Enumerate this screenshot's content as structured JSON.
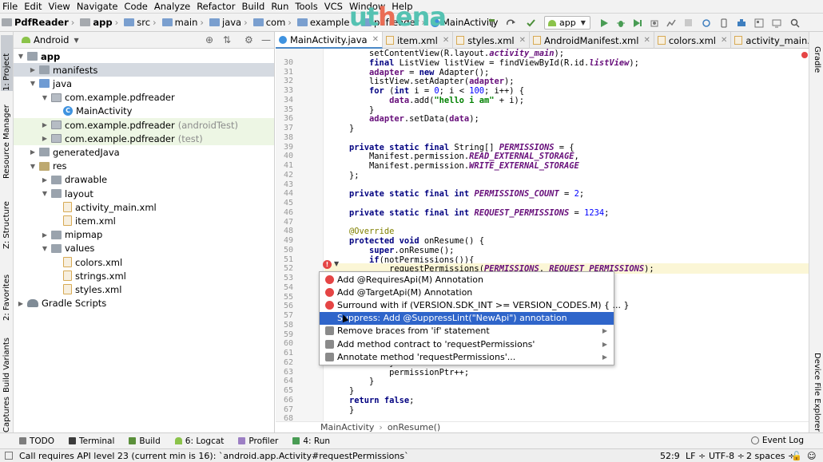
{
  "menu": [
    "File",
    "Edit",
    "View",
    "Navigate",
    "Code",
    "Analyze",
    "Refactor",
    "Build",
    "Run",
    "Tools",
    "VCS",
    "Window",
    "Help"
  ],
  "breadcrumbs": [
    {
      "label": "PdfReader",
      "bold": true
    },
    {
      "label": "app",
      "bold": true
    },
    {
      "label": "src"
    },
    {
      "label": "main"
    },
    {
      "label": "java"
    },
    {
      "label": "com"
    },
    {
      "label": "example"
    },
    {
      "label": "pdfreader"
    },
    {
      "label": "MainActivity"
    }
  ],
  "watermark": {
    "part1": "ut",
    "part2": "h",
    "part3": "ena"
  },
  "run_config": "app",
  "left_tool_windows": [
    "1: Project",
    "Resource Manager",
    "Z: Structure",
    "2: Favorites",
    "Build Variants",
    "Captures"
  ],
  "right_tool_windows": [
    "Gradle",
    "Device File Explorer"
  ],
  "project": {
    "view_mode": "Android",
    "tree": [
      {
        "label": "app",
        "depth": 0,
        "expanded": true,
        "icon": "folder",
        "bold": true
      },
      {
        "label": "manifests",
        "depth": 1,
        "expanded": false,
        "icon": "folder",
        "selected": true
      },
      {
        "label": "java",
        "depth": 1,
        "expanded": true,
        "icon": "folder-src"
      },
      {
        "label": "com.example.pdfreader",
        "depth": 2,
        "expanded": true,
        "icon": "package"
      },
      {
        "label": "MainActivity",
        "depth": 3,
        "icon": "class"
      },
      {
        "label": "com.example.pdfreader",
        "suffix": "(androidTest)",
        "depth": 2,
        "expanded": false,
        "icon": "package",
        "green": true
      },
      {
        "label": "com.example.pdfreader",
        "suffix": "(test)",
        "depth": 2,
        "expanded": false,
        "icon": "package",
        "green": true
      },
      {
        "label": "generatedJava",
        "depth": 1,
        "expanded": false,
        "icon": "folder"
      },
      {
        "label": "res",
        "depth": 1,
        "expanded": true,
        "icon": "folder-res"
      },
      {
        "label": "drawable",
        "depth": 2,
        "expanded": false,
        "icon": "folder"
      },
      {
        "label": "layout",
        "depth": 2,
        "expanded": true,
        "icon": "folder"
      },
      {
        "label": "activity_main.xml",
        "depth": 3,
        "icon": "xml"
      },
      {
        "label": "item.xml",
        "depth": 3,
        "icon": "xml"
      },
      {
        "label": "mipmap",
        "depth": 2,
        "expanded": false,
        "icon": "folder"
      },
      {
        "label": "values",
        "depth": 2,
        "expanded": true,
        "icon": "folder"
      },
      {
        "label": "colors.xml",
        "depth": 3,
        "icon": "xml"
      },
      {
        "label": "strings.xml",
        "depth": 3,
        "icon": "xml"
      },
      {
        "label": "styles.xml",
        "depth": 3,
        "icon": "xml"
      },
      {
        "label": "Gradle Scripts",
        "depth": 0,
        "expanded": false,
        "icon": "gradle"
      }
    ]
  },
  "tabs": [
    {
      "label": "MainActivity.java",
      "type": "java",
      "active": true
    },
    {
      "label": "item.xml",
      "type": "xml"
    },
    {
      "label": "styles.xml",
      "type": "xml"
    },
    {
      "label": "AndroidManifest.xml",
      "type": "xml"
    },
    {
      "label": "colors.xml",
      "type": "xml"
    },
    {
      "label": "activity_main.xml",
      "type": "xml"
    }
  ],
  "code_lines": [
    {
      "n": "",
      "html": "        <span>setContentView(R.layout.</span><span class=\"fld\">activity_main</span><span>);</span>"
    },
    {
      "n": "30",
      "html": "        <span class=\"kw\">final</span> ListView listView = findViewById(R.id.<span class=\"fld\">listView</span>);"
    },
    {
      "n": "31",
      "html": "        <span class=\"fld\" style=\"font-style:normal\">adapter</span> = <span class=\"kw\">new</span> Adapter();"
    },
    {
      "n": "32",
      "html": "        listView.setAdapter(<span class=\"fld\" style=\"font-style:normal\">adapter</span>);"
    },
    {
      "n": "33",
      "html": "        <span class=\"kw\">for</span> (<span class=\"kw\">int</span> i = <span class=\"num\">0</span>; i &lt; <span class=\"num\">100</span>; i++) {"
    },
    {
      "n": "34",
      "html": "            <span class=\"fld\" style=\"font-style:normal\">data</span>.add(<span class=\"str\">\"hello i am\"</span> + i);"
    },
    {
      "n": "35",
      "html": "        }"
    },
    {
      "n": "36",
      "html": "        <span class=\"fld\" style=\"font-style:normal\">adapter</span>.setData(<span class=\"fld\" style=\"font-style:normal\">data</span>);"
    },
    {
      "n": "37",
      "html": "    }"
    },
    {
      "n": "38",
      "html": ""
    },
    {
      "n": "39",
      "html": "    <span class=\"kw\">private static final</span> String[] <span class=\"fld\">PERMISSIONS</span> = {"
    },
    {
      "n": "40",
      "html": "        Manifest.permission.<span class=\"fld\">READ_EXTERNAL_STORAGE</span>,"
    },
    {
      "n": "41",
      "html": "        Manifest.permission.<span class=\"fld\">WRITE_EXTERNAL_STORAGE</span>"
    },
    {
      "n": "42",
      "html": "    };"
    },
    {
      "n": "43",
      "html": ""
    },
    {
      "n": "44",
      "html": "    <span class=\"kw\">private static final int</span> <span class=\"fld\">PERMISSIONS_COUNT</span> = <span class=\"num\">2</span>;"
    },
    {
      "n": "45",
      "html": ""
    },
    {
      "n": "46",
      "html": "    <span class=\"kw\">private static final int</span> <span class=\"fld\">REQUEST_PERMISSIONS</span> = <span class=\"num\">1234</span>;"
    },
    {
      "n": "47",
      "html": ""
    },
    {
      "n": "48",
      "html": "    <span class=\"ann\">@Override</span>"
    },
    {
      "n": "49",
      "html": "    <span class=\"kw\">protected void</span> onResume() {"
    },
    {
      "n": "50",
      "html": "        <span class=\"kw\">super</span>.onResume();"
    },
    {
      "n": "51",
      "html": "        <span class=\"kw\">if</span>(notPermissions()){"
    },
    {
      "n": "52",
      "html": "            <u>requestPermissions</u>(<span class=\"fld\">PERMISSIONS</span>, <span class=\"fld\">REQUEST_PERMISSIONS</span>);"
    },
    {
      "n": "53",
      "html": ""
    },
    {
      "n": "54",
      "html": ""
    },
    {
      "n": "55",
      "html": ""
    },
    {
      "n": "56",
      "html": ""
    },
    {
      "n": "57",
      "html": ""
    },
    {
      "n": "58",
      "html": ""
    },
    {
      "n": "59",
      "html": ""
    },
    {
      "n": "60",
      "html": ""
    },
    {
      "n": "61",
      "html": ""
    },
    {
      "n": "62",
      "html": "            }"
    },
    {
      "n": "63",
      "html": "            permissionPtr++;"
    },
    {
      "n": "64",
      "html": "        }"
    },
    {
      "n": "65",
      "html": "    }"
    },
    {
      "n": "66",
      "html": "    <span class=\"kw\">return false</span>;"
    },
    {
      "n": "67",
      "html": "    }"
    },
    {
      "n": "68",
      "html": ""
    }
  ],
  "popup": {
    "items": [
      {
        "label": "Add @RequiresApi(M) Annotation",
        "icon": "error"
      },
      {
        "label": "Add @TargetApi(M) Annotation",
        "icon": "error"
      },
      {
        "label": "Surround with if (VERSION.SDK_INT >= VERSION_CODES.M) { ... }",
        "icon": "error"
      },
      {
        "label": "Suppress: Add @SuppressLint(\"NewApi\") annotation",
        "icon": "none",
        "selected": true
      },
      {
        "label": "Remove braces from 'if' statement",
        "icon": "wrench",
        "submenu": true
      },
      {
        "label": "Add method contract to 'requestPermissions'",
        "icon": "wrench",
        "submenu": true
      },
      {
        "label": "Annotate method 'requestPermissions'...",
        "icon": "wrench",
        "submenu": true
      }
    ]
  },
  "editor_breadcrumb": [
    "MainActivity",
    "onResume()"
  ],
  "bottom_tools": [
    {
      "label": "TODO"
    },
    {
      "label": "Terminal"
    },
    {
      "label": "Build"
    },
    {
      "label": "6: Logcat"
    },
    {
      "label": "Profiler"
    },
    {
      "label": "4: Run"
    }
  ],
  "event_log": "Event Log",
  "status": {
    "message": "Call requires API level 23 (current min is 16): `android.app.Activity#requestPermissions`",
    "position": "52:9",
    "line_sep": "LF",
    "encoding": "UTF-8",
    "indent": "2 spaces"
  },
  "colors": {
    "selection": "#2f65ca",
    "error": "#e54545",
    "accent": "#4a88c7"
  }
}
